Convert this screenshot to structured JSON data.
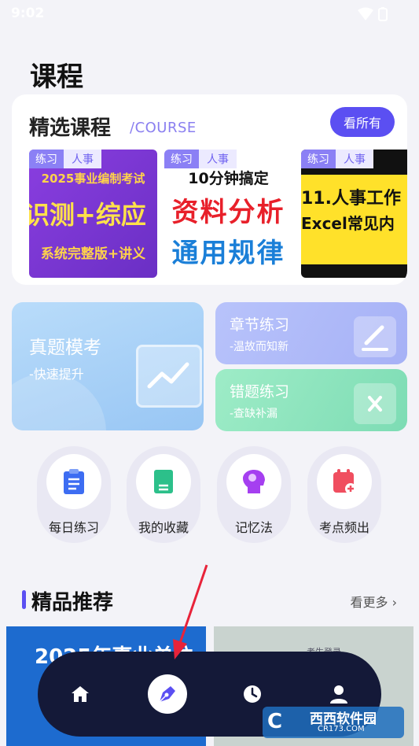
{
  "status": {
    "time": "9:02"
  },
  "page": {
    "title": "课程"
  },
  "courses": {
    "title": "精选课程",
    "subtitle": "/COURSE",
    "see_all": "看所有",
    "items": [
      {
        "tag1": "练习",
        "tag2": "人事",
        "line1": "2025事业编制考试",
        "line2": "识测+综应",
        "line3": "系统完整版+讲义"
      },
      {
        "tag1": "练习",
        "tag2": "人事",
        "line1": "10分钟搞定",
        "line2": "资料分析",
        "line3": "通用规律"
      },
      {
        "tag1": "练习",
        "tag2": "人事",
        "line1": "11.人事工作",
        "line2": "Excel常见内"
      }
    ]
  },
  "tiles": {
    "exam": {
      "title": "真题模考",
      "sub": "-快速提升"
    },
    "chapter": {
      "title": "章节练习",
      "sub": "-温故而知新"
    },
    "wrong": {
      "title": "错题练习",
      "sub": "-查缺补漏"
    }
  },
  "quick_actions": [
    {
      "label": "每日练习",
      "icon": "clipboard-icon",
      "color": "#3d6df2"
    },
    {
      "label": "我的收藏",
      "icon": "bookmark-icon",
      "color": "#2cc08a"
    },
    {
      "label": "记忆法",
      "icon": "brain-head-icon",
      "color": "#a53ff0"
    },
    {
      "label": "考点频出",
      "icon": "calendar-plus-icon",
      "color": "#f04e5f"
    }
  ],
  "recommend": {
    "title": "精品推荐",
    "see_more": "看更多",
    "img1_text": "2025年事业单位",
    "img2_text": "考生登录"
  },
  "nav": {
    "items": [
      "home-icon",
      "pen-icon",
      "clock-icon",
      "user-icon"
    ],
    "active_index": 1
  },
  "watermark": {
    "logo": "C",
    "name": "西西软件园",
    "url": "CR173.COM"
  },
  "colors": {
    "accent": "#5b4ff2",
    "nav_bg": "#141938",
    "arrow": "#e8233a"
  }
}
